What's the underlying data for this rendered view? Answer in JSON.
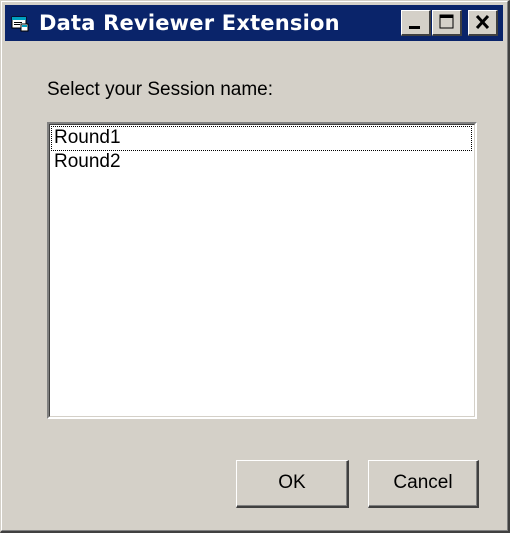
{
  "window": {
    "title": "Data Reviewer Extension",
    "title_icon": "app-window-icon",
    "controls": {
      "minimize_icon": "minimize-icon",
      "maximize_icon": "maximize-icon",
      "close_icon": "close-icon"
    }
  },
  "dialog": {
    "prompt": "Select your Session name:",
    "sessions": [
      {
        "label": "Round1",
        "focused": true
      },
      {
        "label": "Round2",
        "focused": false
      }
    ],
    "ok_label": "OK",
    "cancel_label": "Cancel"
  },
  "colors": {
    "titlebar": "#0a246a",
    "face": "#d4d0c8",
    "list_background": "#ffffff"
  }
}
